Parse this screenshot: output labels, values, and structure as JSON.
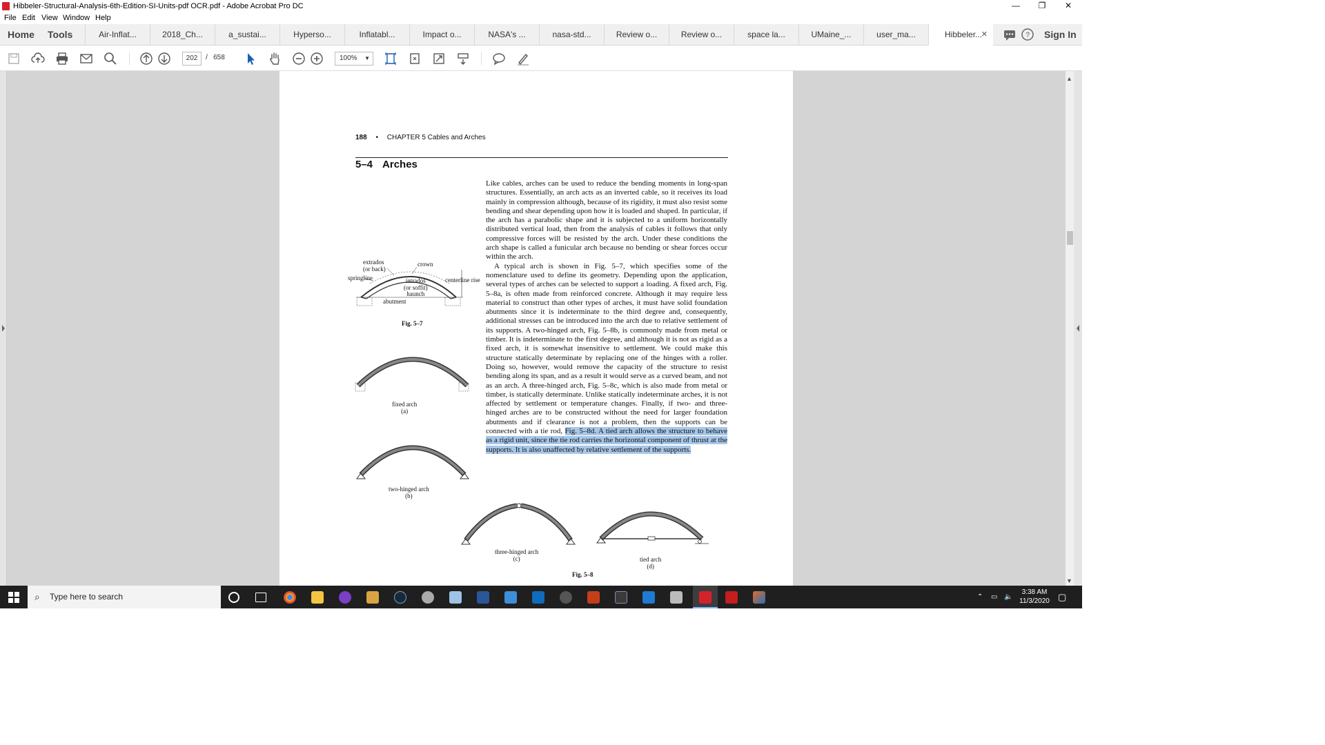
{
  "window": {
    "title": "Hibbeler-Structural-Analysis-6th-Edition-SI-Units-pdf OCR.pdf - Adobe Acrobat Pro DC",
    "controls": {
      "minimize": "—",
      "restore": "❐",
      "close": "✕"
    }
  },
  "menu": [
    "File",
    "Edit",
    "View",
    "Window",
    "Help"
  ],
  "nav": {
    "home": "Home",
    "tools": "Tools"
  },
  "tabs": [
    "Air-Inflat...",
    "2018_Ch...",
    "a_sustai...",
    "Hyperso...",
    "Inflatabl...",
    "Impact o...",
    "NASA's ...",
    "nasa-std...",
    "Review o...",
    "Review o...",
    "space la...",
    "UMaine_...",
    "user_ma...",
    "Hibbeler..."
  ],
  "sign_in": "Sign In",
  "toolbar": {
    "page_current": "202",
    "page_separator": "/",
    "page_total": "658",
    "zoom": "100%"
  },
  "page": {
    "running_head_number": "188",
    "running_head_bullet": "•",
    "running_head_text": "CHAPTER 5  Cables and Arches",
    "section_number": "5–4",
    "section_title": "Arches",
    "para1": "Like cables, arches can be used to reduce the bending moments in long-span structures. Essentially, an arch acts as an inverted cable, so it receives its load mainly in compression although, because of its rigidity, it must also resist some bending and shear depending upon how it is loaded and shaped. In particular, if the arch has a parabolic shape and it is subjected to a uniform horizontally distributed vertical load, then from the analysis of cables it follows that only compressive forces will be resisted by the arch. Under these conditions the arch shape is called a funicular arch because no bending or shear forces occur within the arch.",
    "para2_plain": "A typical arch is shown in Fig. 5–7, which specifies some of the nomenclature used to define its geometry. Depending upon the application, several types of arches can be selected to support a loading. A fixed arch, Fig. 5–8a, is often made from reinforced concrete. Although it may require less material to construct than other types of arches, it must have solid foundation abutments since it is indeterminate to the third degree and, consequently, additional stresses can be introduced into the arch due to relative settlement of its supports. A two-hinged arch, Fig. 5–8b, is commonly made from metal or timber. It is indeterminate to the first degree, and although it is not as rigid as a fixed arch, it is somewhat insensitive to settlement. We could make this structure statically determinate by replacing one of the hinges with a roller. Doing so, however, would remove the capacity of the structure to resist bending along its span, and as a result it would serve as a curved beam, and not as an arch. A three-hinged arch, Fig. 5–8c, which is also made from metal or timber, is statically determinate. Unlike statically indeterminate arches, it is not affected by settlement or temperature changes. Finally, if two- and three-hinged arches are to be constructed without the need for larger foundation abutments and if clearance is not a problem, then the supports can be connected with a tie rod,",
    "para2_highlight": "Fig. 5–8d. A tied arch allows the structure to behave as a rigid unit, since the tie rod carries the horizontal component of thrust at the supports. It is also unaffected by relative settlement of the supports.",
    "fig57_labels": {
      "extrados": "extrados",
      "or_back": "(or back)",
      "crown": "crown",
      "springline": "springline",
      "intrados": "intrados",
      "or_soffit": "(or soffit)",
      "haunch": "haunch",
      "centerline_rise": "centerline rise",
      "abutment": "abutment",
      "caption": "Fig. 5–7"
    },
    "fig58": {
      "a_name": "fixed arch",
      "a_letter": "(a)",
      "b_name": "two-hinged arch",
      "b_letter": "(b)",
      "c_name": "three-hinged arch",
      "c_letter": "(c)",
      "d_name": "tied arch",
      "d_letter": "(d)",
      "caption": "Fig. 5–8"
    }
  },
  "taskbar": {
    "search_placeholder": "Type here to search",
    "time": "3:38 AM",
    "date": "11/3/2020"
  }
}
